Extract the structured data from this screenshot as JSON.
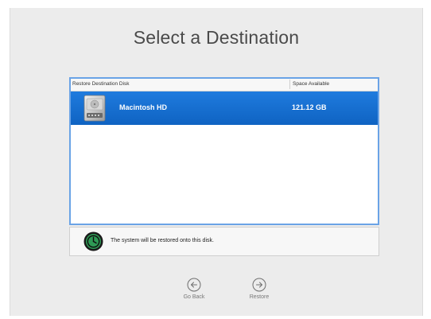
{
  "page": {
    "title": "Select a Destination"
  },
  "table": {
    "columns": {
      "disk": "Restore Destination Disk",
      "space": "Space Available"
    },
    "rows": [
      {
        "name": "Macintosh HD",
        "space": "121.12 GB",
        "selected": true,
        "icon": "hard-drive-icon"
      }
    ]
  },
  "info": {
    "text": "The system will be restored onto this disk.",
    "icon": "time-machine-icon"
  },
  "buttons": {
    "back": {
      "label": "Go Back",
      "icon": "arrow-left-circle-icon"
    },
    "restore": {
      "label": "Restore",
      "icon": "arrow-right-circle-icon"
    }
  },
  "colors": {
    "selection": "#1f7bde",
    "table_border": "#6aa3e6",
    "background": "#ececec"
  }
}
